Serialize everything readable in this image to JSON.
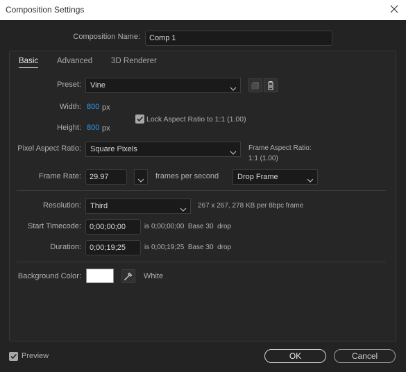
{
  "window": {
    "title": "Composition Settings"
  },
  "comp_name": {
    "label": "Composition Name:",
    "value": "Comp 1"
  },
  "tabs": [
    {
      "label": "Basic",
      "active": true
    },
    {
      "label": "Advanced",
      "active": false
    },
    {
      "label": "3D Renderer",
      "active": false
    }
  ],
  "preset": {
    "label": "Preset:",
    "value": "Vine"
  },
  "width": {
    "label": "Width:",
    "value": "800",
    "unit": "px"
  },
  "height": {
    "label": "Height:",
    "value": "800",
    "unit": "px"
  },
  "lock_aspect": {
    "label": "Lock Aspect Ratio to 1:1 (1.00)",
    "checked": true
  },
  "pixel_aspect": {
    "label": "Pixel Aspect Ratio:",
    "value": "Square Pixels"
  },
  "frame_aspect": {
    "label": "Frame Aspect Ratio:",
    "value": "1:1 (1.00)"
  },
  "frame_rate": {
    "label": "Frame Rate:",
    "value": "29.97",
    "unit": "frames per second",
    "drop": "Drop Frame"
  },
  "resolution": {
    "label": "Resolution:",
    "value": "Third",
    "info": "267 x 267, 278 KB per 8bpc frame"
  },
  "start_timecode": {
    "label": "Start Timecode:",
    "value": "0;00;00;00",
    "info": "is 0;00;00;00  Base 30  drop"
  },
  "duration": {
    "label": "Duration:",
    "value": "0;00;19;25",
    "info": "is 0;00;19;25  Base 30  drop"
  },
  "background": {
    "label": "Background Color:",
    "color": "#ffffff",
    "name": "White"
  },
  "preview": {
    "label": "Preview",
    "checked": true
  },
  "buttons": {
    "ok": "OK",
    "cancel": "Cancel"
  },
  "colors": {
    "accent": "#2e9bf0",
    "bg": "#232323"
  }
}
